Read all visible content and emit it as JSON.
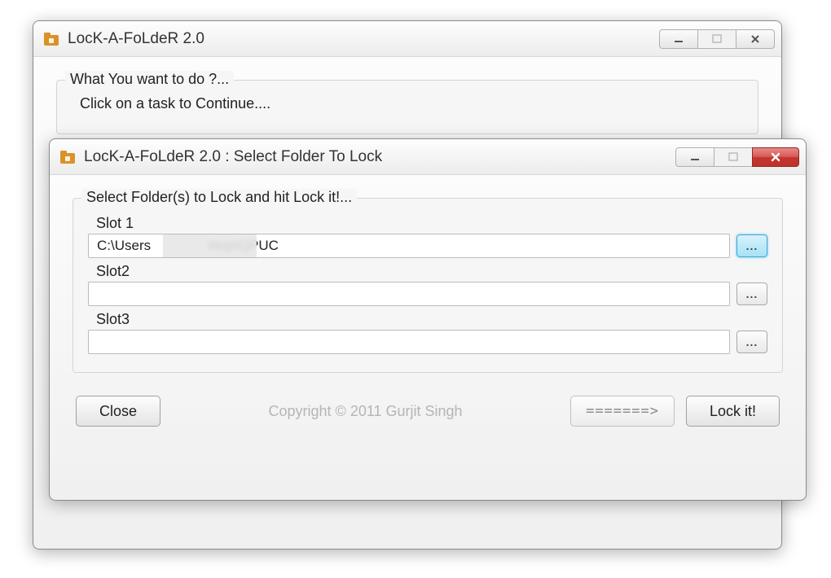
{
  "backWindow": {
    "title": "LocK-A-FoLdeR 2.0",
    "group": {
      "legend": "What You want to do ?...",
      "subtext": "Click on a task to Continue...."
    }
  },
  "frontWindow": {
    "title": "LocK-A-FoLdeR 2.0 : Select Folder To Lock",
    "group": {
      "legend": "Select Folder(s) to Lock and hit Lock it!...",
      "slots": [
        {
          "label": "Slot 1",
          "value": "C:\\Users               ktop\\QPUC",
          "browseActive": true
        },
        {
          "label": "Slot2",
          "value": "",
          "browseActive": false
        },
        {
          "label": "Slot3",
          "value": "",
          "browseActive": false
        }
      ]
    },
    "buttons": {
      "close": "Close",
      "arrowHint": "=======>",
      "lock": "Lock it!"
    },
    "copyright": "Copyright © 2011 Gurjit Singh",
    "browseLabel": "..."
  }
}
